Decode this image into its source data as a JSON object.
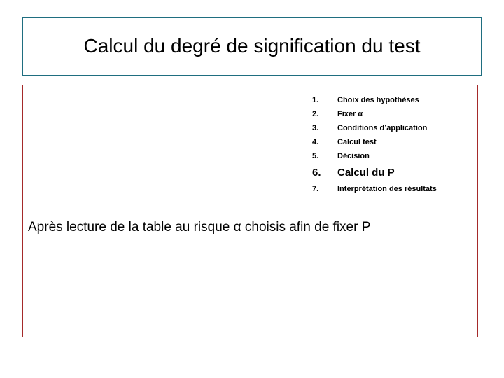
{
  "slide": {
    "title": "Calcul du degré de signification du test",
    "title_border_color": "#1f6e80",
    "content_border_color": "#a52a2a",
    "background_color": "#ffffff",
    "text_color": "#000000"
  },
  "steps": [
    {
      "number": "1.",
      "label": "Choix des hypothèses",
      "emphasis": "normal"
    },
    {
      "number": "2.",
      "label": "Fixer α",
      "emphasis": "normal"
    },
    {
      "number": "3.",
      "label": "Conditions d’application",
      "emphasis": "normal"
    },
    {
      "number": "4.",
      "label": "Calcul test",
      "emphasis": "normal"
    },
    {
      "number": "5.",
      "label": "Décision",
      "emphasis": "normal"
    },
    {
      "number": "6.",
      "label": "Calcul du P",
      "emphasis": "large"
    },
    {
      "number": "7.",
      "label": "Interprétation des résultats",
      "emphasis": "normal"
    }
  ],
  "note": {
    "text": "Après lecture de la table au risque α choisis afin de fixer P"
  }
}
